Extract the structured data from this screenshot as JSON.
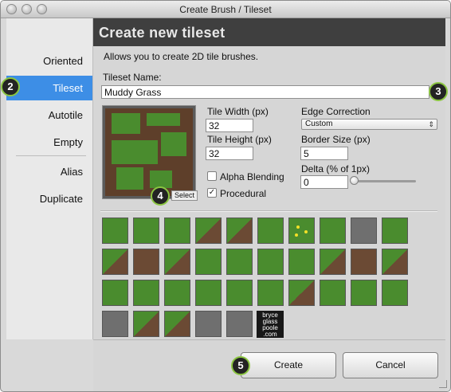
{
  "window": {
    "title": "Create Brush / Tileset"
  },
  "sidebar": {
    "items": [
      {
        "label": "Oriented"
      },
      {
        "label": "Tileset"
      },
      {
        "label": "Autotile"
      },
      {
        "label": "Empty"
      },
      {
        "label": "Alias"
      },
      {
        "label": "Duplicate"
      }
    ]
  },
  "header": {
    "title": "Create new tileset"
  },
  "description": "Allows you to create 2D tile brushes.",
  "tileset": {
    "name_label": "Tileset Name:",
    "name_value": "Muddy Grass",
    "tile_width_label": "Tile Width (px)",
    "tile_width_value": "32",
    "tile_height_label": "Tile Height (px)",
    "tile_height_value": "32",
    "alpha_blending_label": "Alpha Blending",
    "alpha_blending_checked": false,
    "procedural_label": "Procedural",
    "procedural_checked": true,
    "edge_correction_label": "Edge Correction",
    "edge_correction_value": "Custom",
    "border_size_label": "Border Size (px)",
    "border_size_value": "5",
    "delta_label": "Delta (% of 1px)",
    "delta_value": "0",
    "select_label": "Select"
  },
  "watermark": {
    "line1": "bryce",
    "line2": "glass",
    "line3": "poole",
    "line4": ".com"
  },
  "footer": {
    "create_label": "Create",
    "cancel_label": "Cancel"
  },
  "badges": {
    "b2": "2",
    "b3": "3",
    "b4": "4",
    "b5": "5"
  },
  "colors": {
    "accent": "#3d8ee6",
    "header": "#3f3f3f",
    "badge_ring": "#8bc541"
  },
  "icons": {
    "dropdown": "chevron-updown-icon",
    "checkmark": "checkmark-icon",
    "resize": "resize-grip-icon"
  }
}
